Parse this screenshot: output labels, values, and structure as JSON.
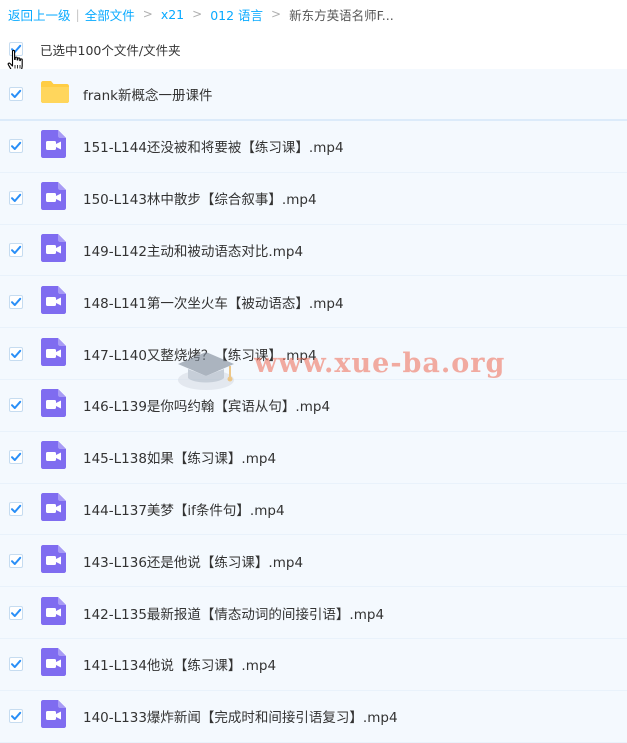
{
  "breadcrumb": {
    "back": "返回上一级",
    "all_files": "全部文件",
    "level1": "x21",
    "level2": "012 语言",
    "current": "新东方英语名师F..."
  },
  "selection": {
    "label": "已选中100个文件/文件夹",
    "checked": true
  },
  "colors": {
    "accent": "#09aaff",
    "checkbox_blue": "#2a8ff7",
    "video_icon": "#7f6cf0",
    "folder": "#ffcd44",
    "row_bg": "#f4f9fe"
  },
  "files": [
    {
      "name": "frank新概念一册课件",
      "type": "folder",
      "icon": "folder-icon"
    },
    {
      "name": "151-L144还没被和将要被【练习课】.mp4",
      "type": "video",
      "icon": "video-file-icon"
    },
    {
      "name": "150-L143林中散步【综合叙事】.mp4",
      "type": "video",
      "icon": "video-file-icon"
    },
    {
      "name": "149-L142主动和被动语态对比.mp4",
      "type": "video",
      "icon": "video-file-icon"
    },
    {
      "name": "148-L141第一次坐火车【被动语态】.mp4",
      "type": "video",
      "icon": "video-file-icon"
    },
    {
      "name": "147-L140又整烧烤？【练习课】.mp4",
      "type": "video",
      "icon": "video-file-icon"
    },
    {
      "name": "146-L139是你吗约翰【宾语从句】.mp4",
      "type": "video",
      "icon": "video-file-icon"
    },
    {
      "name": "145-L138如果【练习课】.mp4",
      "type": "video",
      "icon": "video-file-icon"
    },
    {
      "name": "144-L137美梦【if条件句】.mp4",
      "type": "video",
      "icon": "video-file-icon"
    },
    {
      "name": "143-L136还是他说【练习课】.mp4",
      "type": "video",
      "icon": "video-file-icon"
    },
    {
      "name": "142-L135最新报道【情态动词的间接引语】.mp4",
      "type": "video",
      "icon": "video-file-icon"
    },
    {
      "name": "141-L134他说【练习课】.mp4",
      "type": "video",
      "icon": "video-file-icon"
    },
    {
      "name": "140-L133爆炸新闻【完成时和间接引语复习】.mp4",
      "type": "video",
      "icon": "video-file-icon"
    }
  ],
  "watermark": {
    "text": "www.xue-ba.org"
  }
}
